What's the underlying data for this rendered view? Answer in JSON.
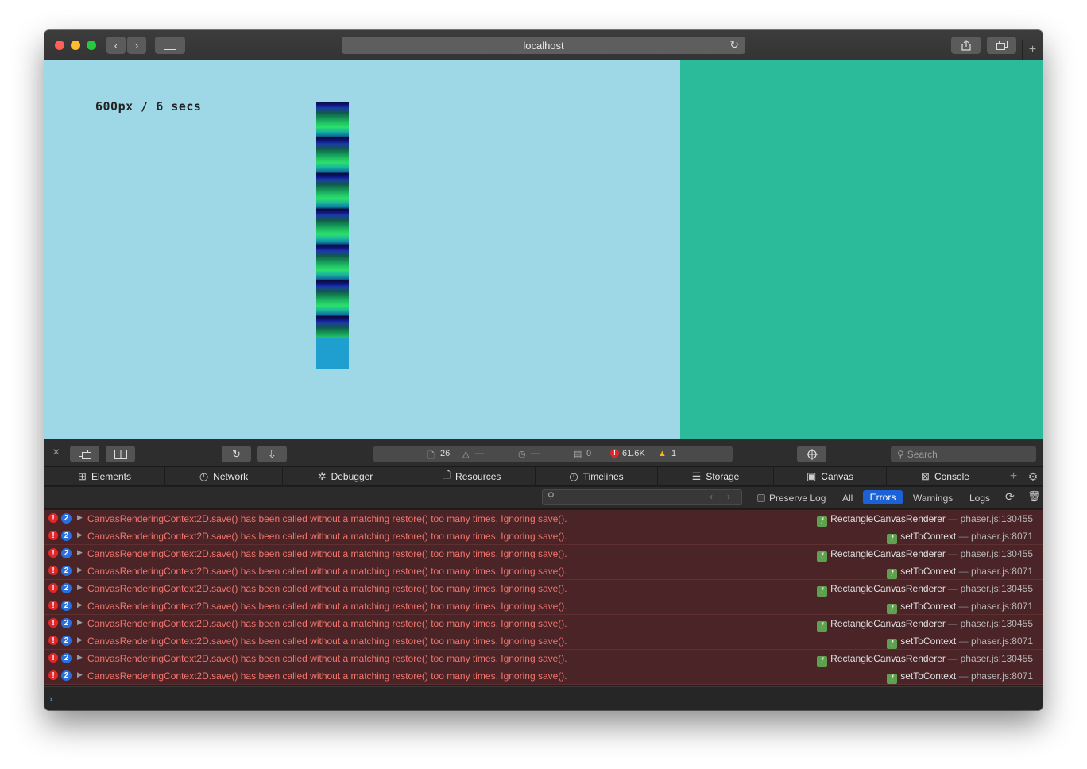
{
  "browser": {
    "url": "localhost"
  },
  "game": {
    "label": "600px / 6 secs"
  },
  "devtools": {
    "activity": {
      "resources_count": "26",
      "network_dash": "—",
      "time_dash": "—",
      "logs_count": "0",
      "errors_count": "61.6K",
      "warnings_count": "1"
    },
    "search_placeholder": "Search",
    "tabs": [
      {
        "label": "Elements",
        "icon": "elements-icon"
      },
      {
        "label": "Network",
        "icon": "network-icon"
      },
      {
        "label": "Debugger",
        "icon": "debugger-icon"
      },
      {
        "label": "Resources",
        "icon": "resources-icon"
      },
      {
        "label": "Timelines",
        "icon": "timelines-icon"
      },
      {
        "label": "Storage",
        "icon": "storage-icon"
      },
      {
        "label": "Canvas",
        "icon": "canvas-icon"
      },
      {
        "label": "Console",
        "icon": "console-icon"
      }
    ],
    "filter": {
      "preserve_log": "Preserve Log",
      "all": "All",
      "errors": "Errors",
      "warnings": "Warnings",
      "logs": "Logs"
    },
    "console_rows": [
      {
        "count": "2",
        "message": "CanvasRenderingContext2D.save() has been called without a matching restore() too many times. Ignoring save().",
        "func": "RectangleCanvasRenderer",
        "location": "phaser.js:130455"
      },
      {
        "count": "2",
        "message": "CanvasRenderingContext2D.save() has been called without a matching restore() too many times. Ignoring save().",
        "func": "setToContext",
        "location": "phaser.js:8071"
      },
      {
        "count": "2",
        "message": "CanvasRenderingContext2D.save() has been called without a matching restore() too many times. Ignoring save().",
        "func": "RectangleCanvasRenderer",
        "location": "phaser.js:130455"
      },
      {
        "count": "2",
        "message": "CanvasRenderingContext2D.save() has been called without a matching restore() too many times. Ignoring save().",
        "func": "setToContext",
        "location": "phaser.js:8071"
      },
      {
        "count": "2",
        "message": "CanvasRenderingContext2D.save() has been called without a matching restore() too many times. Ignoring save().",
        "func": "RectangleCanvasRenderer",
        "location": "phaser.js:130455"
      },
      {
        "count": "2",
        "message": "CanvasRenderingContext2D.save() has been called without a matching restore() too many times. Ignoring save().",
        "func": "setToContext",
        "location": "phaser.js:8071"
      },
      {
        "count": "2",
        "message": "CanvasRenderingContext2D.save() has been called without a matching restore() too many times. Ignoring save().",
        "func": "RectangleCanvasRenderer",
        "location": "phaser.js:130455"
      },
      {
        "count": "2",
        "message": "CanvasRenderingContext2D.save() has been called without a matching restore() too many times. Ignoring save().",
        "func": "setToContext",
        "location": "phaser.js:8071"
      },
      {
        "count": "2",
        "message": "CanvasRenderingContext2D.save() has been called without a matching restore() too many times. Ignoring save().",
        "func": "RectangleCanvasRenderer",
        "location": "phaser.js:130455"
      },
      {
        "count": "2",
        "message": "CanvasRenderingContext2D.save() has been called without a matching restore() too many times. Ignoring save().",
        "func": "setToContext",
        "location": "phaser.js:8071"
      }
    ],
    "colors": {
      "error_text": "#f0766e",
      "error_row": "#4a2426",
      "accent": "#1a62d6"
    }
  }
}
